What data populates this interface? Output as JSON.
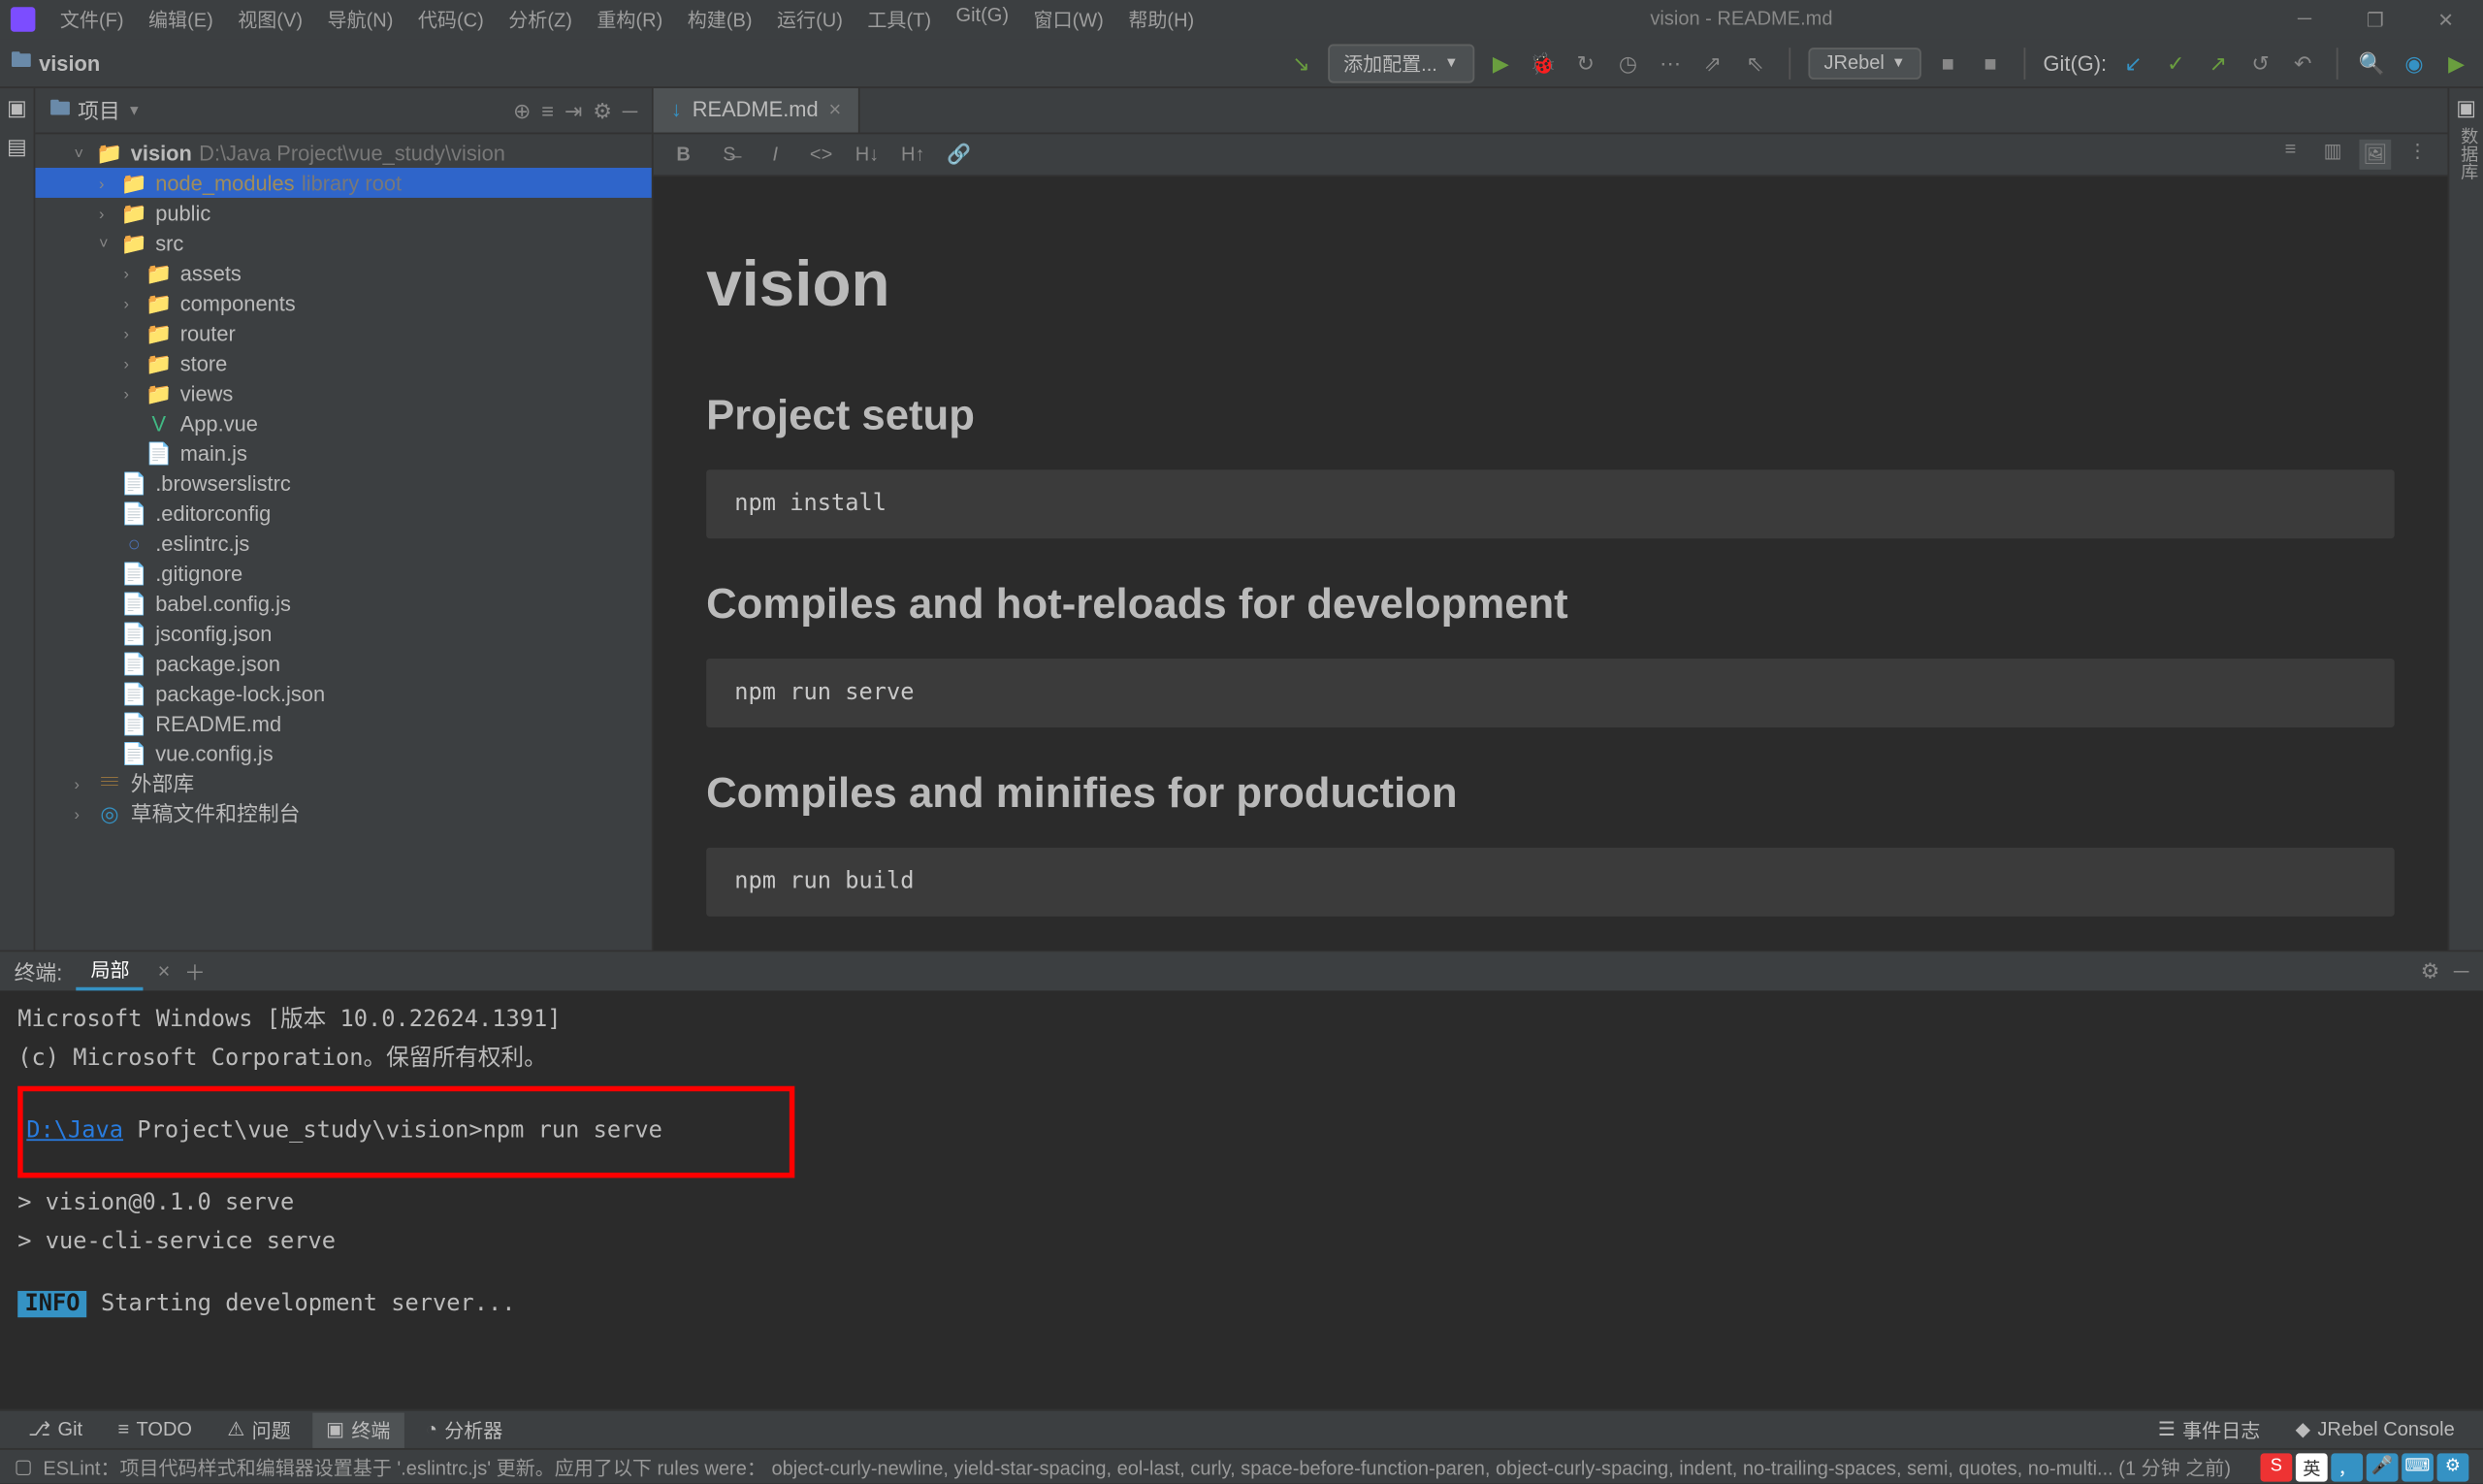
{
  "window": {
    "title": "vision - README.md"
  },
  "menus": [
    "文件(F)",
    "编辑(E)",
    "视图(V)",
    "导航(N)",
    "代码(C)",
    "分析(Z)",
    "重构(R)",
    "构建(B)",
    "运行(U)",
    "工具(T)",
    "Git(G)",
    "窗口(W)",
    "帮助(H)"
  ],
  "breadcrumb": {
    "project": "vision"
  },
  "toolbar": {
    "run_config": "添加配置...",
    "vcs_label": "JRebel",
    "git_label": "Git(G):"
  },
  "project_panel": {
    "title": "项目",
    "root": {
      "name": "vision",
      "path": "D:\\Java Project\\vue_study\\vision"
    },
    "tree": [
      {
        "indent": 1,
        "arrow": "˅",
        "icon": "📁",
        "label": "vision",
        "suffix": "D:\\Java Project\\vue_study\\vision",
        "bold": true
      },
      {
        "indent": 2,
        "arrow": "›",
        "icon": "📁",
        "label": "node_modules",
        "suffix": "library root",
        "muted_label": true,
        "selected": true
      },
      {
        "indent": 2,
        "arrow": "›",
        "icon": "📁",
        "label": "public"
      },
      {
        "indent": 2,
        "arrow": "˅",
        "icon": "📁",
        "label": "src"
      },
      {
        "indent": 3,
        "arrow": "›",
        "icon": "📁",
        "label": "assets"
      },
      {
        "indent": 3,
        "arrow": "›",
        "icon": "📁",
        "label": "components"
      },
      {
        "indent": 3,
        "arrow": "›",
        "icon": "📁",
        "label": "router"
      },
      {
        "indent": 3,
        "arrow": "›",
        "icon": "📁",
        "label": "store"
      },
      {
        "indent": 3,
        "arrow": "›",
        "icon": "📁",
        "label": "views"
      },
      {
        "indent": 3,
        "arrow": "",
        "icon": "V",
        "label": "App.vue",
        "icon_color": "#41b883"
      },
      {
        "indent": 3,
        "arrow": "",
        "icon": "📄",
        "label": "main.js",
        "icon_color": "#e8762d"
      },
      {
        "indent": 2,
        "arrow": "",
        "icon": "📄",
        "label": ".browserslistrc"
      },
      {
        "indent": 2,
        "arrow": "",
        "icon": "📄",
        "label": ".editorconfig"
      },
      {
        "indent": 2,
        "arrow": "",
        "icon": "○",
        "label": ".eslintrc.js",
        "icon_color": "#4b6eaf"
      },
      {
        "indent": 2,
        "arrow": "",
        "icon": "📄",
        "label": ".gitignore"
      },
      {
        "indent": 2,
        "arrow": "",
        "icon": "📄",
        "label": "babel.config.js",
        "icon_color": "#e8762d"
      },
      {
        "indent": 2,
        "arrow": "",
        "icon": "📄",
        "label": "jsconfig.json",
        "icon_color": "#e8762d"
      },
      {
        "indent": 2,
        "arrow": "",
        "icon": "📄",
        "label": "package.json",
        "icon_color": "#e8762d"
      },
      {
        "indent": 2,
        "arrow": "",
        "icon": "📄",
        "label": "package-lock.json",
        "icon_color": "#e8762d"
      },
      {
        "indent": 2,
        "arrow": "",
        "icon": "📄",
        "label": "README.md",
        "icon_color": "#3592c4"
      },
      {
        "indent": 2,
        "arrow": "",
        "icon": "📄",
        "label": "vue.config.js",
        "icon_color": "#e8762d"
      },
      {
        "indent": 1,
        "arrow": "›",
        "icon": "𝄘",
        "label": "外部库",
        "icon_color": "#e8a33d"
      },
      {
        "indent": 1,
        "arrow": "›",
        "icon": "◎",
        "label": "草稿文件和控制台",
        "icon_color": "#3592c4"
      }
    ]
  },
  "editor": {
    "tab": "README.md",
    "content": {
      "h1": "vision",
      "sections": [
        {
          "heading": "Project setup",
          "code": "npm install"
        },
        {
          "heading": "Compiles and hot-reloads for development",
          "code": "npm run serve"
        },
        {
          "heading": "Compiles and minifies for production",
          "code": "npm run build"
        }
      ]
    }
  },
  "terminal": {
    "panel_label": "终端:",
    "tab": "局部",
    "lines": {
      "l1": "Microsoft Windows [版本 10.0.22624.1391]",
      "l2": "(c) Microsoft Corporation。保留所有权利。",
      "prompt_path": "D:\\Java",
      "prompt_rest": " Project\\vue_study\\vision>npm run serve",
      "l4": "> vision@0.1.0 serve",
      "l5": "> vue-cli-service serve",
      "info_label": "INFO",
      "info_msg": " Starting development server..."
    }
  },
  "bottom_tools": {
    "git": "Git",
    "todo": "TODO",
    "problems": "问题",
    "terminal": "终端",
    "analyzer": "分析器",
    "events": "事件日志",
    "jrebel": "JRebel Console"
  },
  "statusbar": {
    "left_prefix": "ESLint：项目代码样式和编辑器设置基于 '.eslintrc.js' 更新。应用了以下 rules were：",
    "left_rules": "object-curly-newline, yield-star-spacing, eol-last, curly, space-before-function-paren, object-curly-spacing, indent, no-trailing-spaces, semi, quotes, no-multi... (1 分钟 之前)",
    "ime": "英"
  }
}
